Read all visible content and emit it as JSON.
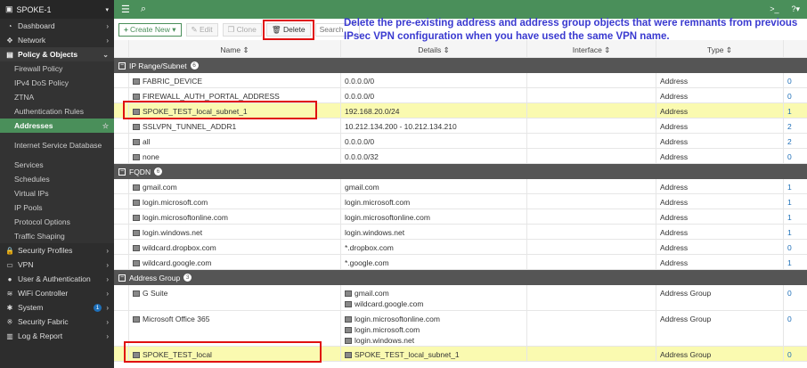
{
  "sidebar": {
    "device": "SPOKE-1",
    "items": [
      {
        "label": "Dashboard",
        "icon": "dashboard-icon"
      },
      {
        "label": "Network",
        "icon": "network-icon"
      },
      {
        "label": "Policy & Objects",
        "icon": "policy-icon"
      },
      {
        "label": "Firewall Policy"
      },
      {
        "label": "IPv4 DoS Policy"
      },
      {
        "label": "ZTNA"
      },
      {
        "label": "Authentication Rules"
      },
      {
        "label": "Addresses"
      },
      {
        "label": "Internet Service Database"
      },
      {
        "label": "Services"
      },
      {
        "label": "Schedules"
      },
      {
        "label": "Virtual IPs"
      },
      {
        "label": "IP Pools"
      },
      {
        "label": "Protocol Options"
      },
      {
        "label": "Traffic Shaping"
      },
      {
        "label": "Security Profiles",
        "icon": "lock-icon"
      },
      {
        "label": "VPN",
        "icon": "vpn-icon"
      },
      {
        "label": "User & Authentication",
        "icon": "user-icon"
      },
      {
        "label": "WiFi Controller",
        "icon": "wifi-icon"
      },
      {
        "label": "System",
        "icon": "gear-icon",
        "badge": "1"
      },
      {
        "label": "Security Fabric",
        "icon": "fabric-icon"
      },
      {
        "label": "Log & Report",
        "icon": "chart-icon"
      }
    ]
  },
  "toolbar": {
    "create": "Create New",
    "edit": "Edit",
    "clone": "Clone",
    "delete": "Delete",
    "search_placeholder": "Search"
  },
  "annotation": "Delete the pre-existing address and address group objects that were remnants from previous IPsec VPN configuration when you have used the same VPN name.",
  "columns": [
    "Name",
    "Details",
    "Interface",
    "Type"
  ],
  "groups": [
    {
      "label": "IP Range/Subnet",
      "count": "6",
      "rows": [
        {
          "name": "FABRIC_DEVICE",
          "details": [
            "0.0.0.0/0"
          ],
          "type": "Address",
          "ref": "0"
        },
        {
          "name": "FIREWALL_AUTH_PORTAL_ADDRESS",
          "details": [
            "0.0.0.0/0"
          ],
          "type": "Address",
          "ref": "0"
        },
        {
          "name": "SPOKE_TEST_local_subnet_1",
          "details": [
            "192.168.20.0/24"
          ],
          "type": "Address",
          "ref": "1",
          "hl": true
        },
        {
          "name": "SSLVPN_TUNNEL_ADDR1",
          "details": [
            "10.212.134.200 - 10.212.134.210"
          ],
          "type": "Address",
          "ref": "2"
        },
        {
          "name": "all",
          "details": [
            "0.0.0.0/0"
          ],
          "type": "Address",
          "ref": "2"
        },
        {
          "name": "none",
          "details": [
            "0.0.0.0/32"
          ],
          "type": "Address",
          "ref": "0"
        }
      ]
    },
    {
      "label": "FQDN",
      "count": "6",
      "rows": [
        {
          "name": "gmail.com",
          "details": [
            "gmail.com"
          ],
          "type": "Address",
          "ref": "1"
        },
        {
          "name": "login.microsoft.com",
          "details": [
            "login.microsoft.com"
          ],
          "type": "Address",
          "ref": "1"
        },
        {
          "name": "login.microsoftonline.com",
          "details": [
            "login.microsoftonline.com"
          ],
          "type": "Address",
          "ref": "1"
        },
        {
          "name": "login.windows.net",
          "details": [
            "login.windows.net"
          ],
          "type": "Address",
          "ref": "1"
        },
        {
          "name": "wildcard.dropbox.com",
          "details": [
            "*.dropbox.com"
          ],
          "type": "Address",
          "ref": "0"
        },
        {
          "name": "wildcard.google.com",
          "details": [
            "*.google.com"
          ],
          "type": "Address",
          "ref": "1"
        }
      ]
    },
    {
      "label": "Address Group",
      "count": "3",
      "rows": [
        {
          "name": "G Suite",
          "details": [
            "gmail.com",
            "wildcard.google.com"
          ],
          "type": "Address Group",
          "ref": "0"
        },
        {
          "name": "Microsoft Office 365",
          "details": [
            "login.microsoftonline.com",
            "login.microsoft.com",
            "login.windows.net"
          ],
          "type": "Address Group",
          "ref": "0"
        },
        {
          "name": "SPOKE_TEST_local",
          "details": [
            "SPOKE_TEST_local_subnet_1"
          ],
          "type": "Address Group",
          "ref": "0",
          "hl": true
        }
      ]
    }
  ]
}
